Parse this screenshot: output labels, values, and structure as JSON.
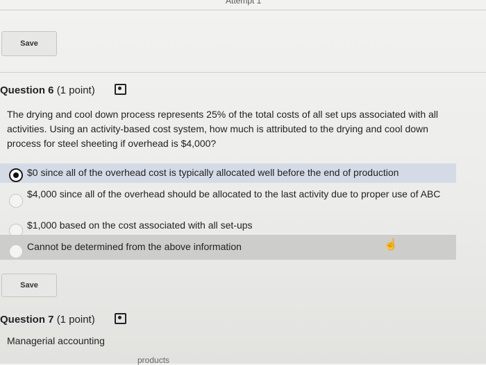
{
  "header": {
    "partial_title": "Attempt 1"
  },
  "save_top": {
    "label": "Save"
  },
  "question6": {
    "number_label": "Question 6",
    "points_label": "(1 point)",
    "prompt": "The drying and cool down process represents 25% of the total costs of all set ups associated with all activities. Using an activity-based cost system, how much is attributed to the drying and cool down process for steel sheeting if overhead is $4,000?",
    "options": [
      {
        "text": "$0 since all of the overhead cost is typically allocated well before the end of production",
        "selected": true
      },
      {
        "text": "$4,000 since all of the overhead should be allocated to the last activity due to proper use of ABC",
        "selected": false
      },
      {
        "text": "$1,000 based on the cost associated with all set-ups",
        "selected": false
      },
      {
        "text": "Cannot be determined from the above information",
        "selected": false
      }
    ]
  },
  "save_middle": {
    "label": "Save"
  },
  "question7": {
    "number_label": "Question 7",
    "points_label": "(1 point)",
    "prompt": "Managerial accounting",
    "partial_text": "products"
  },
  "icons": {
    "lock": "lock-icon",
    "cursor": "hand-pointer-icon"
  }
}
